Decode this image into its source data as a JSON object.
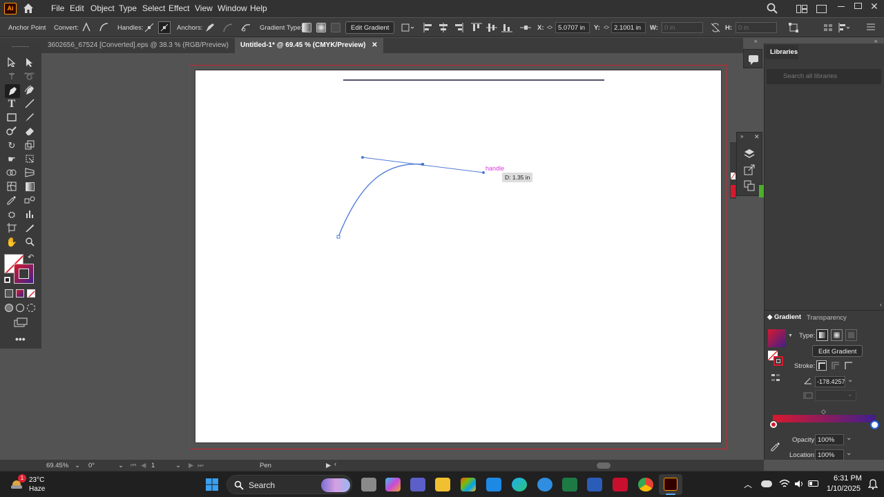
{
  "app": {
    "logo": "Ai"
  },
  "menu": [
    "File",
    "Edit",
    "Object",
    "Type",
    "Select",
    "Effect",
    "View",
    "Window",
    "Help"
  ],
  "control_bar": {
    "anchor_point": "Anchor Point",
    "convert": "Convert:",
    "handles": "Handles:",
    "anchors": "Anchors:",
    "gradient_type": "Gradient Type:",
    "edit_gradient": "Edit Gradient",
    "x_label": "X:",
    "x_value": "5.0707 in",
    "y_label": "Y:",
    "y_value": "2.1001 in",
    "w_label": "W:",
    "w_value": "0 in",
    "h_label": "H:",
    "h_value": "0 in"
  },
  "tabs": [
    {
      "label": "3602656_67524 [Converted].eps @ 38.3 % (RGB/Preview)",
      "close": "✕"
    },
    {
      "label": "Untitled-1* @ 69.45 % (CMYK/Preview)",
      "close": "✕"
    }
  ],
  "canvas": {
    "smart_guide_label": "handle",
    "distance_tooltip": "D: 1.35 in"
  },
  "status": {
    "zoom": "69.45%",
    "rotation": "0°",
    "artboard": "1",
    "tool": "Pen"
  },
  "libraries": {
    "tab": "Libraries",
    "search_placeholder": "Search all libraries"
  },
  "gradient_panel": {
    "tab_gradient": "Gradient",
    "tab_transparency": "Transparency",
    "type_label": "Type:",
    "edit_gradient": "Edit Gradient",
    "stroke_label": "Stroke:",
    "angle_value": "-178.4257",
    "opacity_label": "Opacity:",
    "opacity_value": "100%",
    "location_label": "Location:",
    "location_value": "100%",
    "colors": {
      "start": "#d7192f",
      "end": "#3f1f8c"
    }
  },
  "taskbar": {
    "temperature": "23°C",
    "weather": "Haze",
    "weather_badge": "1",
    "search_label": "Search",
    "time": "6:31 PM",
    "date": "1/10/2025"
  }
}
